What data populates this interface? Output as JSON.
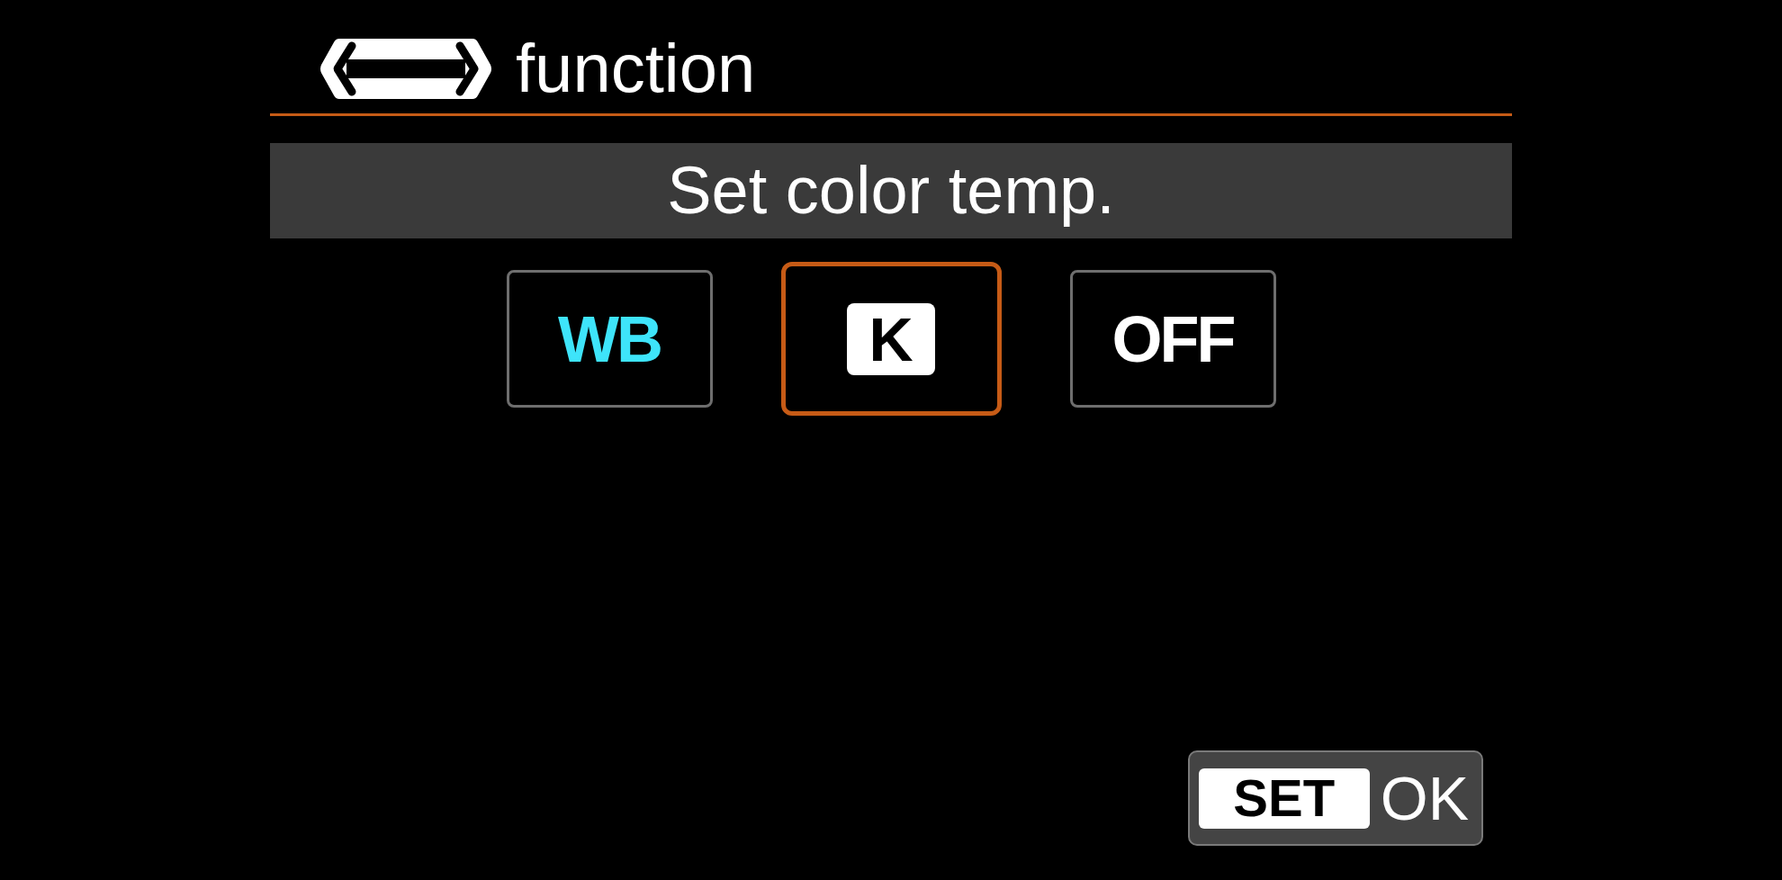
{
  "header": {
    "title": "function"
  },
  "prompt": "Set color temp.",
  "options": [
    {
      "label": "WB",
      "kind": "text",
      "color": "#3ee4fa",
      "selected": false
    },
    {
      "label": "K",
      "kind": "chip",
      "color": "#ffffff",
      "selected": true
    },
    {
      "label": "OFF",
      "kind": "text",
      "color": "#ffffff",
      "selected": false
    }
  ],
  "footer": {
    "key": "SET",
    "action": "OK"
  }
}
